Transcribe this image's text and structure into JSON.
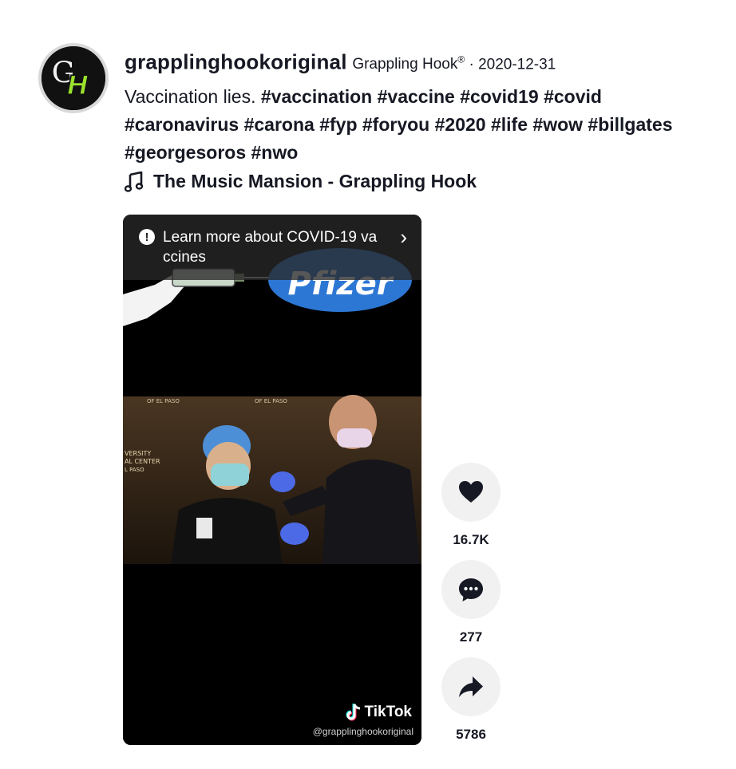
{
  "post": {
    "username": "grapplinghookoriginal",
    "nickname": "Grappling Hook",
    "registered_mark": "®",
    "separator": " · ",
    "date": "2020-12-31",
    "caption_text": "Vaccination lies. ",
    "hashtags": [
      "#vaccination",
      "#vaccine",
      "#covid19",
      "#covid",
      "#caronavirus",
      "#carona",
      "#fyp",
      "#foryou",
      "#2020",
      "#life",
      "#wow",
      "#billgates",
      "#georgesoros",
      "#nwo"
    ],
    "music": "The Music Mansion - Grappling Hook"
  },
  "avatar": {
    "initials": "GH"
  },
  "video": {
    "notice_text": "Learn more about COVID-19 vaccines",
    "notice_icon": "!",
    "notice_chevron": "›",
    "tiktok_label": "TikTok",
    "watermark": "@grapplinghookoriginal",
    "overlay_text": "Pfizer"
  },
  "actions": {
    "likes": "16.7K",
    "comments": "277",
    "shares": "5786"
  },
  "icons": {
    "avatar": "avatar-logo-icon",
    "music": "music-note-icon",
    "notice": "alert-circle-icon",
    "chevron": "chevron-right-icon",
    "tiktok": "tiktok-logo-icon",
    "like": "heart-icon",
    "comment": "comment-icon",
    "share": "share-icon"
  },
  "colors": {
    "text": "#161823",
    "action_bg": "#f1f1f2",
    "video_bg": "#000000",
    "avatar_green": "#9be22d"
  }
}
